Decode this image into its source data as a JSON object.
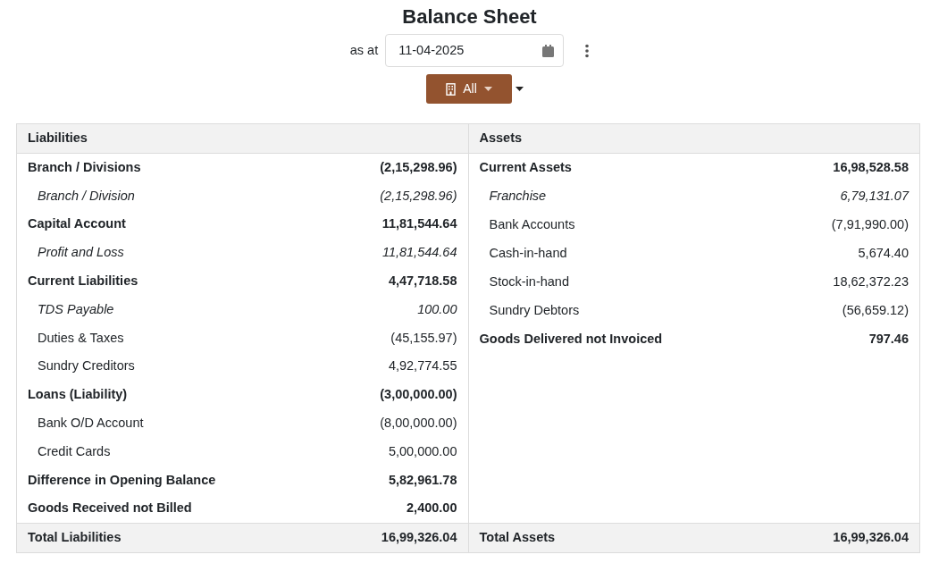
{
  "title": "Balance Sheet",
  "date_filter": {
    "label": "as at",
    "value": "11-04-2025"
  },
  "branch_filter": {
    "label": "All"
  },
  "sides": [
    {
      "heading": "Liabilities",
      "rows": [
        {
          "kind": "group",
          "name": "Branch / Divisions",
          "amount": "(2,15,298.96)"
        },
        {
          "kind": "subgroup",
          "name": "Branch / Division",
          "amount": "(2,15,298.96)"
        },
        {
          "kind": "group",
          "name": "Capital Account",
          "amount": "11,81,544.64"
        },
        {
          "kind": "subgroup",
          "name": "Profit and Loss",
          "amount": "11,81,544.64"
        },
        {
          "kind": "group",
          "name": "Current Liabilities",
          "amount": "4,47,718.58"
        },
        {
          "kind": "subgroup",
          "name": "TDS Payable",
          "amount": "100.00"
        },
        {
          "kind": "ledger",
          "name": "Duties & Taxes",
          "amount": "(45,155.97)"
        },
        {
          "kind": "ledger",
          "name": "Sundry Creditors",
          "amount": "4,92,774.55"
        },
        {
          "kind": "group",
          "name": "Loans (Liability)",
          "amount": "(3,00,000.00)"
        },
        {
          "kind": "ledger",
          "name": "Bank O/D Account",
          "amount": "(8,00,000.00)"
        },
        {
          "kind": "ledger",
          "name": "Credit Cards",
          "amount": "5,00,000.00"
        },
        {
          "kind": "group",
          "name": "Difference in Opening Balance",
          "amount": "5,82,961.78"
        },
        {
          "kind": "group",
          "name": "Goods Received not Billed",
          "amount": "2,400.00"
        }
      ],
      "total": {
        "name": "Total Liabilities",
        "amount": "16,99,326.04"
      }
    },
    {
      "heading": "Assets",
      "rows": [
        {
          "kind": "group",
          "name": "Current Assets",
          "amount": "16,98,528.58"
        },
        {
          "kind": "subgroup",
          "name": "Franchise",
          "amount": "6,79,131.07"
        },
        {
          "kind": "ledger",
          "name": "Bank Accounts",
          "amount": "(7,91,990.00)"
        },
        {
          "kind": "ledger",
          "name": "Cash-in-hand",
          "amount": "5,674.40"
        },
        {
          "kind": "ledger",
          "name": "Stock-in-hand",
          "amount": "18,62,372.23"
        },
        {
          "kind": "ledger",
          "name": "Sundry Debtors",
          "amount": "(56,659.12)"
        },
        {
          "kind": "group",
          "name": "Goods Delivered not Invoiced",
          "amount": "797.46"
        }
      ],
      "total": {
        "name": "Total Assets",
        "amount": "16,99,326.04"
      }
    }
  ]
}
